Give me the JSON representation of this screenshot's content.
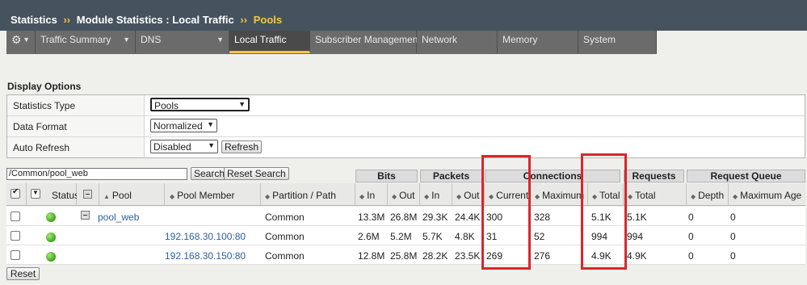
{
  "breadcrumb": {
    "part1": "Statistics",
    "sep": "››",
    "part2": "Module Statistics : Local Traffic",
    "part3": "Pools"
  },
  "menu": {
    "gear": "⚙",
    "items": [
      {
        "label": "Traffic Summary"
      },
      {
        "label": "DNS"
      },
      {
        "label": "Local Traffic"
      },
      {
        "label": "Subscriber Management"
      },
      {
        "label": "Network"
      },
      {
        "label": "Memory"
      },
      {
        "label": "System"
      }
    ]
  },
  "display_options": {
    "title": "Display Options",
    "statistics_type_label": "Statistics Type",
    "statistics_type_value": "Pools",
    "data_format_label": "Data Format",
    "data_format_value": "Normalized",
    "auto_refresh_label": "Auto Refresh",
    "auto_refresh_value": "Disabled",
    "refresh_button": "Refresh"
  },
  "filter": {
    "value": "/Common/pool_web",
    "search_button": "Search",
    "reset_search_button": "Reset Search"
  },
  "table": {
    "groups": {
      "bits": "Bits",
      "packets": "Packets",
      "connections": "Connections",
      "requests": "Requests",
      "request_queue": "Request Queue"
    },
    "columns": {
      "status": "Status",
      "pool": "Pool",
      "pool_member": "Pool Member",
      "partition": "Partition / Path",
      "bits_in": "In",
      "bits_out": "Out",
      "packets_in": "In",
      "packets_out": "Out",
      "conn_current": "Current",
      "conn_maximum": "Maximum",
      "conn_total": "Total",
      "req_total": "Total",
      "queue_depth": "Depth",
      "queue_max_age": "Maximum Age"
    },
    "rows": [
      {
        "pool": "pool_web",
        "member": "",
        "partition": "Common",
        "bits_in": "13.3M",
        "bits_out": "26.8M",
        "pkts_in": "29.3K",
        "pkts_out": "24.4K",
        "current": "300",
        "maximum": "328",
        "total": "5.1K",
        "req_total": "5.1K",
        "depth": "0",
        "max_age": "0"
      },
      {
        "pool": "",
        "member": "192.168.30.100:80",
        "partition": "Common",
        "bits_in": "2.6M",
        "bits_out": "5.2M",
        "pkts_in": "5.7K",
        "pkts_out": "4.8K",
        "current": "31",
        "maximum": "52",
        "total": "994",
        "req_total": "994",
        "depth": "0",
        "max_age": "0"
      },
      {
        "pool": "",
        "member": "192.168.30.150:80",
        "partition": "Common",
        "bits_in": "12.8M",
        "bits_out": "25.8M",
        "pkts_in": "28.2K",
        "pkts_out": "23.5K",
        "current": "269",
        "maximum": "276",
        "total": "4.9K",
        "req_total": "4.9K",
        "depth": "0",
        "max_age": "0"
      }
    ],
    "reset_button": "Reset"
  },
  "colors": {
    "header_bg": "#46535f",
    "accent": "#f5c542",
    "highlight": "#d9262c",
    "status_ok": "#3aa51b"
  }
}
